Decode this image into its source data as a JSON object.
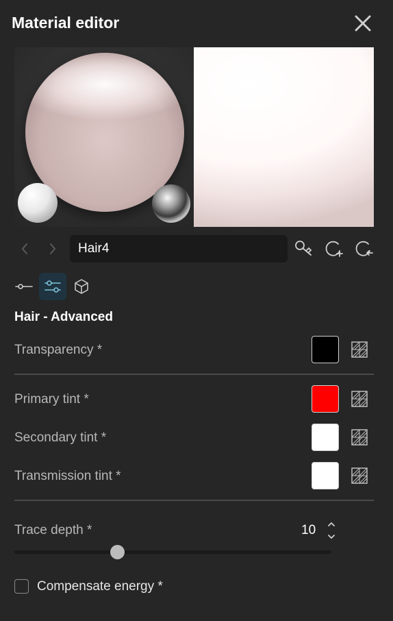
{
  "window": {
    "title": "Material editor"
  },
  "icons": {
    "close": "close-icon",
    "prev": "chevron-left-icon",
    "next": "chevron-right-icon",
    "picker": "eyedropper-icon",
    "add_material": "add-material-icon",
    "reset_material": "reset-material-icon",
    "tab_basic": "node-icon",
    "tab_advanced": "sliders-icon",
    "tab_3d": "cube-icon",
    "texture": "texture-icon",
    "spinner": "spinner-icon"
  },
  "material": {
    "name": "Hair4"
  },
  "tabs": {
    "active": "advanced"
  },
  "section": {
    "title": "Hair - Advanced"
  },
  "properties": {
    "transparency": {
      "label": "Transparency *",
      "color": "#000000"
    },
    "primary_tint": {
      "label": "Primary tint *",
      "color": "#ff0000"
    },
    "secondary_tint": {
      "label": "Secondary tint *",
      "color": "#ffffff"
    },
    "transmission_tint": {
      "label": "Transmission tint *",
      "color": "#ffffff"
    }
  },
  "trace_depth": {
    "label": "Trace depth *",
    "value": "10",
    "fraction": 0.325
  },
  "compensate_energy": {
    "label": "Compensate energy *",
    "checked": false
  },
  "colors": {
    "accent_tab": "#1f3440",
    "background": "#262626"
  }
}
